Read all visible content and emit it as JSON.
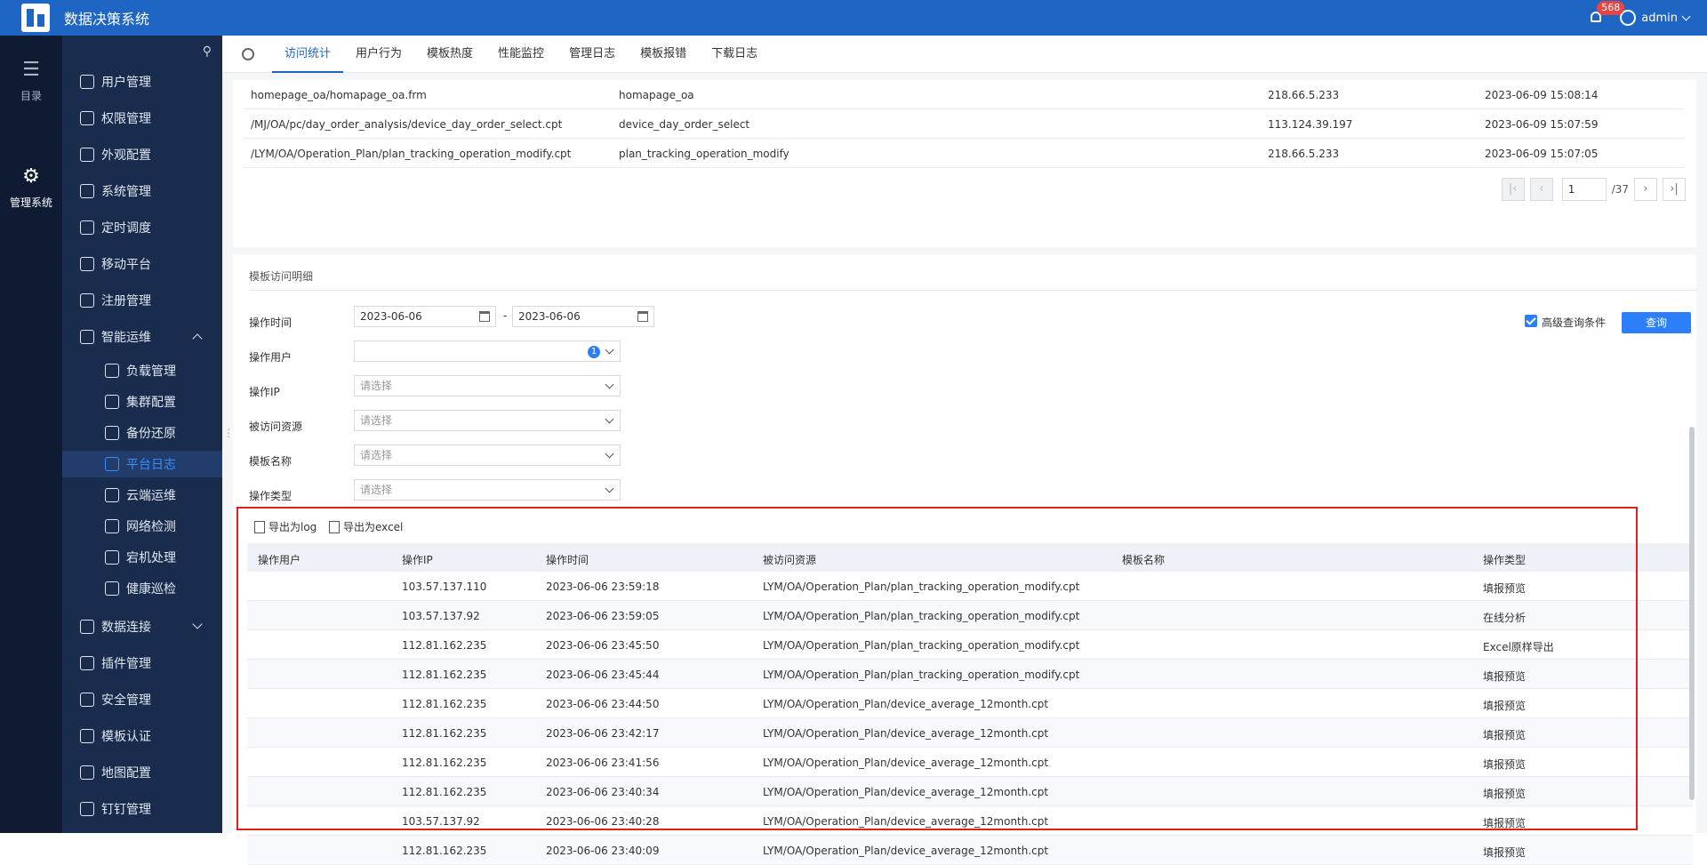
{
  "app": {
    "title": "数据决策系统",
    "notifications": "568",
    "user": "admin"
  },
  "rail": [
    {
      "label": "目录",
      "icon": "list-icon"
    },
    {
      "label": "管理系统",
      "icon": "gear-icon"
    }
  ],
  "sidebar": {
    "items": [
      {
        "label": "用户管理"
      },
      {
        "label": "权限管理"
      },
      {
        "label": "外观配置"
      },
      {
        "label": "系统管理"
      },
      {
        "label": "定时调度"
      },
      {
        "label": "移动平台"
      },
      {
        "label": "注册管理"
      },
      {
        "label": "智能运维"
      },
      {
        "label": "负载管理"
      },
      {
        "label": "集群配置"
      },
      {
        "label": "备份还原"
      },
      {
        "label": "平台日志"
      },
      {
        "label": "云端运维"
      },
      {
        "label": "网络检测"
      },
      {
        "label": "宕机处理"
      },
      {
        "label": "健康巡检"
      },
      {
        "label": "数据连接"
      },
      {
        "label": "插件管理"
      },
      {
        "label": "安全管理"
      },
      {
        "label": "模板认证"
      },
      {
        "label": "地图配置"
      },
      {
        "label": "钉钉管理"
      }
    ]
  },
  "tabs": [
    "访问统计",
    "用户行为",
    "模板热度",
    "性能监控",
    "管理日志",
    "模板报错",
    "下载日志"
  ],
  "top_table": {
    "rows": [
      [
        "homepage_oa/homapage_oa.frm",
        "homapage_oa",
        "218.66.5.233",
        "2023-06-09 15:08:14"
      ],
      [
        "/MJ/OA/pc/day_order_analysis/device_day_order_select.cpt",
        "device_day_order_select",
        "113.124.39.197",
        "2023-06-09 15:07:59"
      ],
      [
        "/LYM/OA/Operation_Plan/plan_tracking_operation_modify.cpt",
        "plan_tracking_operation_modify",
        "218.66.5.233",
        "2023-06-09 15:07:05"
      ]
    ],
    "page": "1",
    "total": "/37"
  },
  "detail": {
    "title": "模板访问明细",
    "labels": {
      "time": "操作时间",
      "user": "操作用户",
      "ip": "操作IP",
      "resource": "被访问资源",
      "template": "模板名称",
      "type": "操作类型"
    },
    "date_from": "2023-06-06",
    "date_to": "2023-06-06",
    "date_sep": "-",
    "user_count": "1",
    "placeholder": "请选择",
    "advanced": "高级查询条件",
    "query": "查询",
    "export_log": "导出为log",
    "export_excel": "导出为excel"
  },
  "log_table": {
    "headers": [
      "操作用户",
      "操作IP",
      "操作时间",
      "被访问资源",
      "模板名称",
      "操作类型"
    ],
    "rows": [
      [
        "",
        "103.57.137.110",
        "2023-06-06 23:59:18",
        "LYM/OA/Operation_Plan/plan_tracking_operation_modify.cpt",
        "",
        "填报预览"
      ],
      [
        "",
        "103.57.137.92",
        "2023-06-06 23:59:05",
        "LYM/OA/Operation_Plan/plan_tracking_operation_modify.cpt",
        "",
        "在线分析"
      ],
      [
        "",
        "112.81.162.235",
        "2023-06-06 23:45:50",
        "LYM/OA/Operation_Plan/plan_tracking_operation_modify.cpt",
        "",
        "Excel原样导出"
      ],
      [
        "",
        "112.81.162.235",
        "2023-06-06 23:45:44",
        "LYM/OA/Operation_Plan/plan_tracking_operation_modify.cpt",
        "",
        "填报预览"
      ],
      [
        "",
        "112.81.162.235",
        "2023-06-06 23:44:50",
        "LYM/OA/Operation_Plan/device_average_12month.cpt",
        "",
        "填报预览"
      ],
      [
        "",
        "112.81.162.235",
        "2023-06-06 23:42:17",
        "LYM/OA/Operation_Plan/device_average_12month.cpt",
        "",
        "填报预览"
      ],
      [
        "",
        "112.81.162.235",
        "2023-06-06 23:41:56",
        "LYM/OA/Operation_Plan/device_average_12month.cpt",
        "",
        "填报预览"
      ],
      [
        "",
        "112.81.162.235",
        "2023-06-06 23:40:34",
        "LYM/OA/Operation_Plan/device_average_12month.cpt",
        "",
        "填报预览"
      ],
      [
        "",
        "103.57.137.92",
        "2023-06-06 23:40:28",
        "LYM/OA/Operation_Plan/device_average_12month.cpt",
        "",
        "填报预览"
      ],
      [
        "",
        "112.81.162.235",
        "2023-06-06 23:40:09",
        "LYM/OA/Operation_Plan/device_average_12month.cpt",
        "",
        "填报预览"
      ]
    ]
  }
}
